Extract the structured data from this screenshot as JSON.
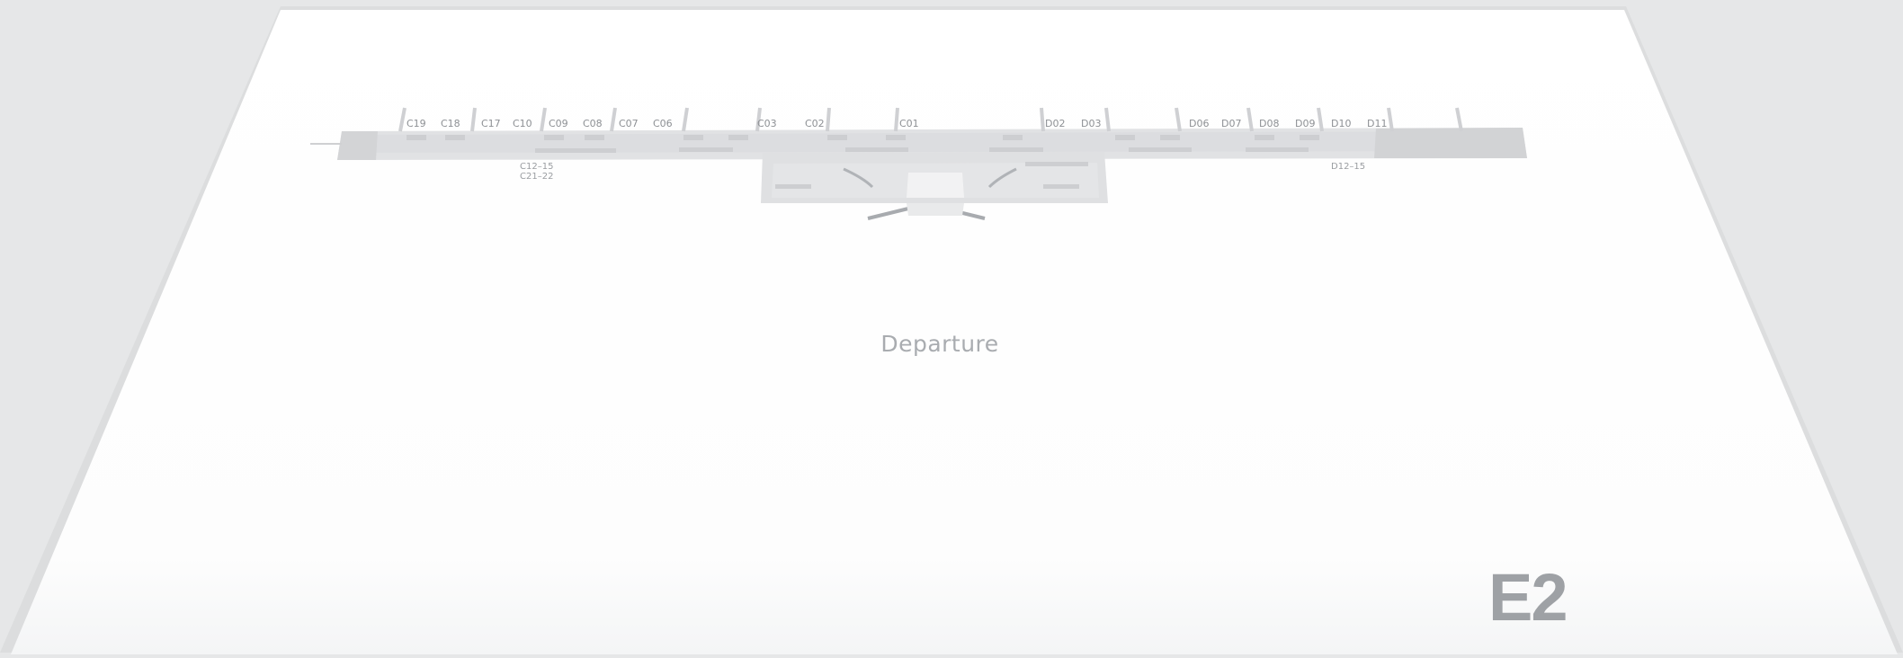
{
  "map": {
    "level_label": "Departure",
    "terminal_code": "E2",
    "gates_c": [
      "C19",
      "C18",
      "C17",
      "C10",
      "C09",
      "C08",
      "C07",
      "C06",
      "C03",
      "C02",
      "C01"
    ],
    "gates_d": [
      "D02",
      "D03",
      "D06",
      "D07",
      "D08",
      "D09",
      "D10",
      "D11"
    ],
    "stair_notes_left": [
      "C12–15",
      "C21–22"
    ],
    "stair_note_right": "D12–15",
    "colors": {
      "background": "#e6e7e8",
      "sheet": "#ffffff",
      "concourse": "#dfe0e2",
      "label": "#9ea1a5"
    }
  }
}
